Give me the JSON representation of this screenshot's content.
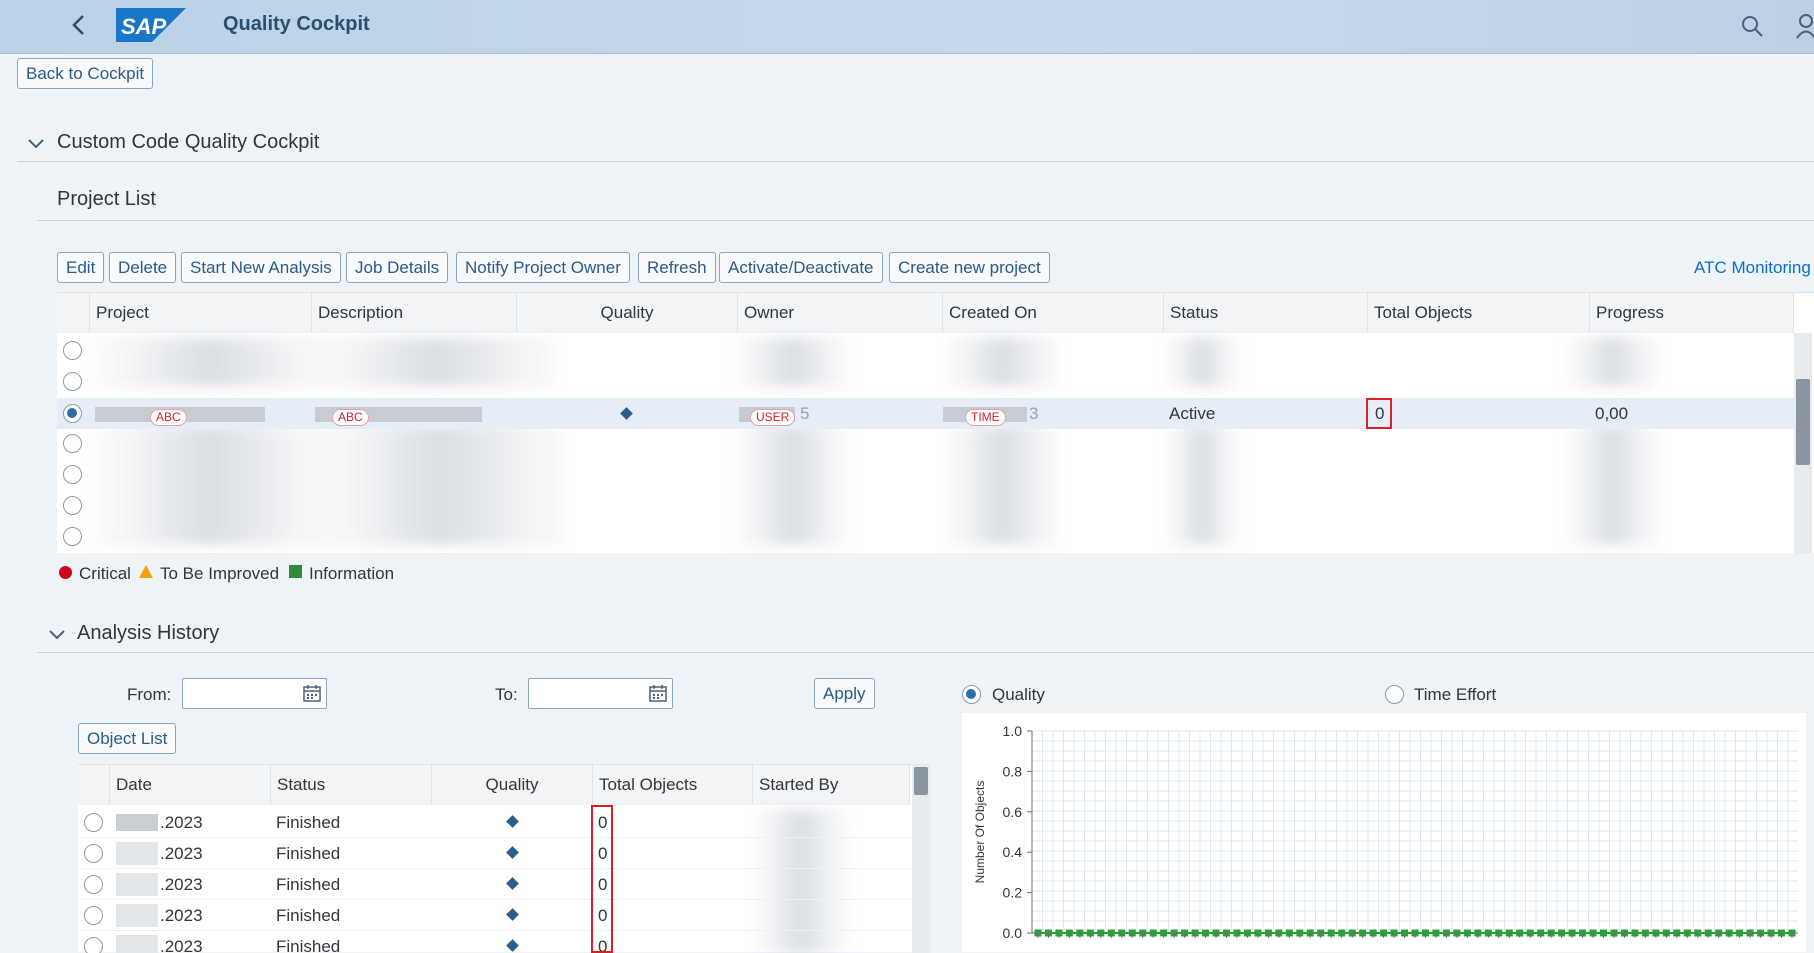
{
  "shell": {
    "title": "Quality Cockpit",
    "logo_text": "SAP"
  },
  "back_button": "Back to Cockpit",
  "cockpit_section": {
    "title": "Custom Code Quality Cockpit"
  },
  "project_list": {
    "title": "Project List",
    "toolbar": [
      "Edit",
      "Delete",
      "Start New Analysis",
      "Job Details",
      "Notify Project Owner",
      "Refresh",
      "Activate/Deactivate",
      "Create new project"
    ],
    "atc_link": "ATC Monitoring",
    "columns": [
      "Project",
      "Description",
      "Quality",
      "Owner",
      "Created On",
      "Status",
      "Total Objects",
      "Progress"
    ],
    "selected_row": {
      "project_tag": "ABC",
      "description_tag": "ABC",
      "owner_tag": "USER",
      "owner_suffix": "5",
      "created_tag": "TIME",
      "created_suffix": "3",
      "status": "Active",
      "total_objects": "0",
      "progress": "0,00"
    }
  },
  "legend": {
    "critical": "Critical",
    "to_be_improved": "To Be Improved",
    "information": "Information",
    "colors": {
      "critical": "#d0021b",
      "to_be_improved": "#f0a30a",
      "information": "#2e8b3a"
    }
  },
  "analysis_history": {
    "title": "Analysis History",
    "from_label": "From:",
    "to_label": "To:",
    "apply": "Apply",
    "object_list": "Object List",
    "columns": [
      "Date",
      "Status",
      "Quality",
      "Total Objects",
      "Started By"
    ],
    "rows": [
      {
        "date": ".2023",
        "status": "Finished",
        "total": "0"
      },
      {
        "date": ".2023",
        "status": "Finished",
        "total": "0"
      },
      {
        "date": ".2023",
        "status": "Finished",
        "total": "0"
      },
      {
        "date": ".2023",
        "status": "Finished",
        "total": "0"
      },
      {
        "date": ".2023",
        "status": "Finished",
        "total": "0"
      }
    ],
    "radio_quality": "Quality",
    "radio_time_effort": "Time Effort"
  },
  "chart_data": {
    "type": "line",
    "ylabel": "Number Of Objects",
    "ylim": [
      0,
      1.0
    ],
    "yticks": [
      "1.0",
      "0.8",
      "0.6",
      "0.4",
      "0.2",
      "0.0"
    ],
    "series": [
      {
        "values": [
          0,
          0,
          0,
          0,
          0,
          0,
          0,
          0,
          0,
          0,
          0,
          0,
          0,
          0,
          0,
          0,
          0,
          0,
          0,
          0,
          0,
          0,
          0,
          0,
          0,
          0,
          0,
          0,
          0,
          0,
          0,
          0,
          0,
          0,
          0,
          0,
          0,
          0,
          0,
          0,
          0,
          0,
          0,
          0,
          0,
          0,
          0,
          0,
          0,
          0,
          0,
          0,
          0,
          0,
          0,
          0,
          0,
          0,
          0,
          0,
          0,
          0,
          0,
          0,
          0,
          0,
          0,
          0,
          0,
          0,
          0,
          0,
          0
        ]
      }
    ],
    "grid": true,
    "color": "#2e9e3a"
  }
}
